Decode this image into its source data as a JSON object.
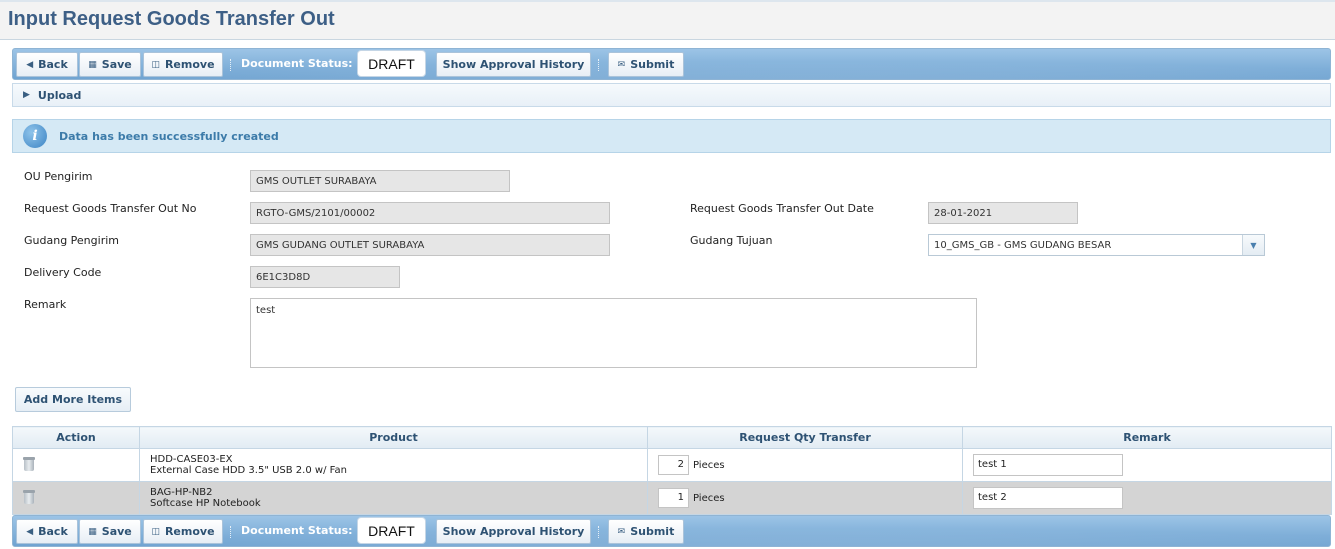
{
  "page": {
    "title": "Input Request Goods Transfer Out"
  },
  "toolbar": {
    "back_label": "Back",
    "save_label": "Save",
    "remove_label": "Remove",
    "doc_status_label": "Document Status:",
    "doc_status_value": "DRAFT",
    "approval_history_label": "Show Approval History",
    "submit_label": "Submit"
  },
  "upload": {
    "label": "Upload"
  },
  "info": {
    "message": "Data has been successfully created"
  },
  "form": {
    "ou_pengirim": {
      "label": "OU Pengirim",
      "value": "GMS OUTLET SURABAYA"
    },
    "request_no": {
      "label": "Request Goods Transfer Out No",
      "value": "RGTO-GMS/2101/00002"
    },
    "request_date": {
      "label": "Request Goods Transfer Out Date",
      "value": "28-01-2021"
    },
    "gudang_pengirim": {
      "label": "Gudang Pengirim",
      "value": "GMS GUDANG OUTLET SURABAYA"
    },
    "gudang_tujuan": {
      "label": "Gudang Tujuan",
      "value": "10_GMS_GB - GMS GUDANG BESAR"
    },
    "delivery_code": {
      "label": "Delivery Code",
      "value": "6E1C3D8D"
    },
    "remark": {
      "label": "Remark",
      "value": "test"
    }
  },
  "add_items": {
    "label": "Add More Items"
  },
  "grid": {
    "columns": [
      "Action",
      "Product",
      "Request Qty Transfer",
      "Remark"
    ],
    "rows": [
      {
        "code": "HDD-CASE03-EX",
        "name": "External Case HDD 3.5\" USB 2.0 w/ Fan",
        "qty": "2",
        "unit": "Pieces",
        "remark": "test 1"
      },
      {
        "code": "BAG-HP-NB2",
        "name": "Softcase HP Notebook",
        "qty": "1",
        "unit": "Pieces",
        "remark": "test 2"
      }
    ]
  },
  "icons": {
    "back": "caret-left-icon",
    "save": "floppy-icon",
    "remove": "trash-icon",
    "submit": "envelope-icon",
    "upload": "caret-right-icon",
    "info": "info-icon"
  }
}
